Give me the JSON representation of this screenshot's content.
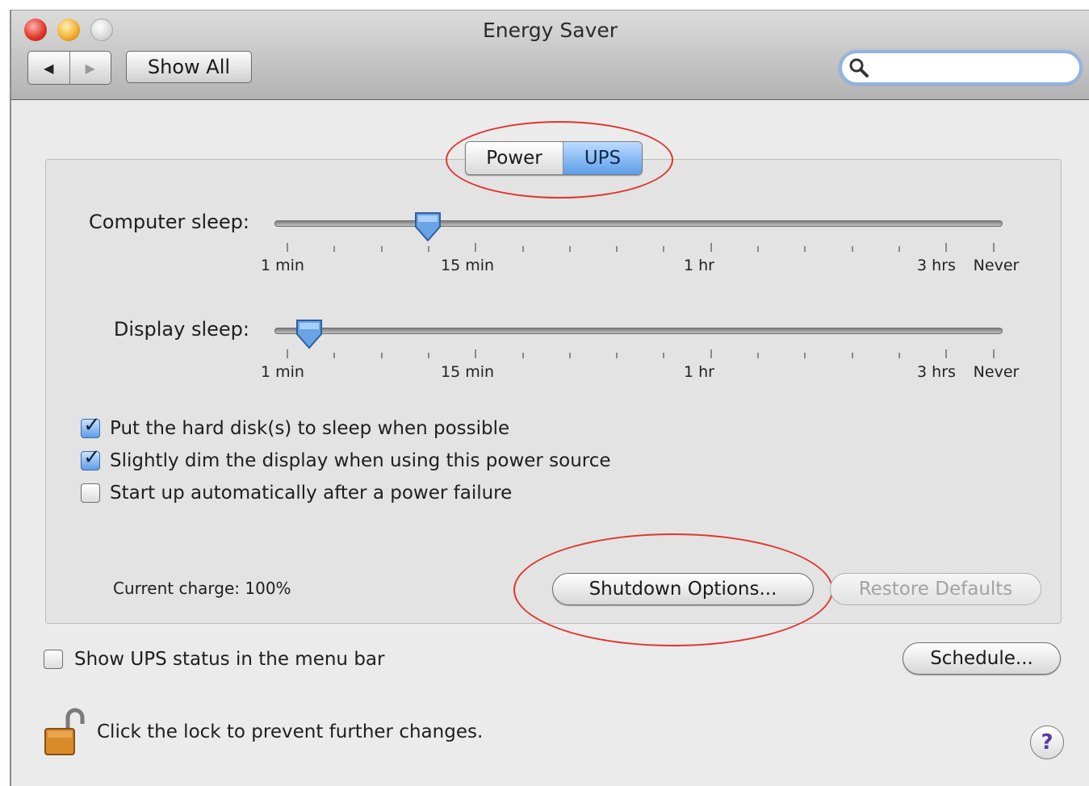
{
  "window": {
    "title": "Energy Saver",
    "nav_back": "◀",
    "nav_forward": "▶",
    "show_all": "Show All",
    "search_placeholder": "",
    "search_value": ""
  },
  "tabs": [
    {
      "label": "Power",
      "selected": false
    },
    {
      "label": "UPS",
      "selected": true
    }
  ],
  "sliders": {
    "computer_sleep": {
      "label": "Computer sleep:",
      "value": "10 min",
      "position_fraction": 0.21
    },
    "display_sleep": {
      "label": "Display sleep:",
      "value": "3 min",
      "position_fraction": 0.05
    },
    "tick_labels": [
      "1 min",
      "15 min",
      "1 hr",
      "3 hrs",
      "Never"
    ]
  },
  "checkboxes": [
    {
      "label": "Put the hard disk(s) to sleep when possible",
      "checked": true
    },
    {
      "label": "Slightly dim the display when using this power source",
      "checked": true
    },
    {
      "label": "Start up automatically after a power failure",
      "checked": false
    }
  ],
  "status": {
    "current_charge": "Current charge: 100%"
  },
  "buttons": {
    "shutdown_options": "Shutdown Options...",
    "restore_defaults": "Restore Defaults",
    "schedule": "Schedule..."
  },
  "menu_bar_checkbox": {
    "label": "Show UPS status in the menu bar",
    "checked": false
  },
  "lock": {
    "text": "Click the lock to prevent further changes.",
    "locked": false
  },
  "help": {
    "label": "?"
  },
  "colors": {
    "annotation_red": "#e0352b",
    "selected_blue": "#5e9ee9"
  }
}
